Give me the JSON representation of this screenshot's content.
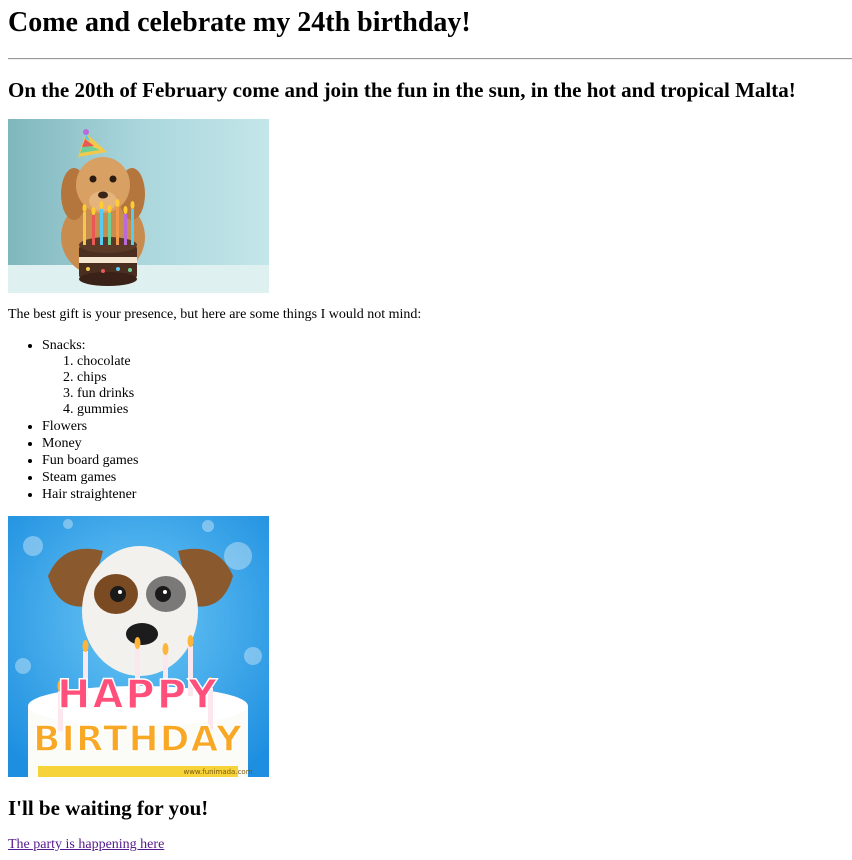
{
  "heading": "Come and celebrate my 24th birthday!",
  "subheading": "On the 20th of February come and join the fun in the sun, in the hot and tropical Malta!",
  "images": {
    "dog_with_cake": "dog-with-party-hat-and-cake",
    "happy_birthday": "puppy-happy-birthday-cake",
    "watermark": "www.funimada.com"
  },
  "intro": "The best gift is your presence, but here are some things I would not mind:",
  "gifts": {
    "snacks_label": "Snacks:",
    "snacks": [
      "chocolate",
      "chips",
      "fun drinks",
      "gummies"
    ],
    "others": [
      "Flowers",
      "Money",
      "Fun board games",
      "Steam games",
      "Hair straightener"
    ]
  },
  "card_text": {
    "happy": "HAPPY",
    "birthday": "BIRTHDAY"
  },
  "closing": "I'll be waiting for you!",
  "link": {
    "text": "The party is happening here"
  },
  "colors": {
    "link_visited": "#551a8b",
    "rule": "#9a9a9a"
  }
}
